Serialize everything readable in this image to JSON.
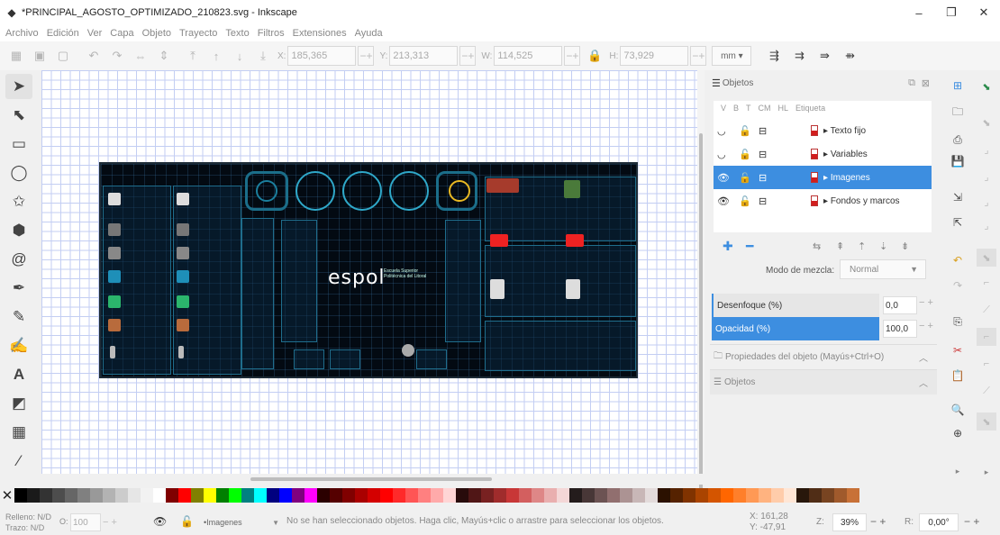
{
  "window": {
    "title": "*PRINCIPAL_AGOSTO_OPTIMIZADO_210823.svg - Inkscape",
    "minimize": "–",
    "maximize": "❐",
    "close": "✕"
  },
  "menu": [
    "Archivo",
    "Edición",
    "Ver",
    "Capa",
    "Objeto",
    "Trayecto",
    "Texto",
    "Filtros",
    "Extensiones",
    "Ayuda"
  ],
  "toolbar": {
    "x_label": "X:",
    "x_value": "185,365",
    "y_label": "Y:",
    "y_value": "213,313",
    "w_label": "W:",
    "w_value": "114,525",
    "h_label": "H:",
    "h_value": "73,929",
    "unit": "mm ▾",
    "minus": "−",
    "plus": "+"
  },
  "objects_panel": {
    "title": "Objetos",
    "columns": [
      "V",
      "B",
      "T",
      "CM",
      "HL",
      "Etiqueta"
    ],
    "layers": [
      {
        "name": "Texto fijo",
        "selected": false
      },
      {
        "name": "Variables",
        "selected": false
      },
      {
        "name": "Imagenes",
        "selected": true
      },
      {
        "name": "Fondos y marcos",
        "selected": false
      }
    ],
    "blend_label": "Modo de mezcla:",
    "blend_value": "Normal",
    "blur_label": "Desenfoque (%)",
    "blur_value": "0,0",
    "opacity_label": "Opacidad (%)",
    "opacity_value": "100,0",
    "props_section": "Propiedades del objeto (Mayús+Ctrl+O)",
    "objects_section": "Objetos"
  },
  "canvas": {
    "brand": "espol",
    "brand_sub": "Escuela Superior Politécnica del Litoral"
  },
  "status": {
    "fill_label": "Relleno: N/D",
    "stroke_label": "Trazo:",
    "stroke_value": "N/D",
    "o_label": "O:",
    "o_value": "100",
    "layer_value": "•Imagenes",
    "message": "No se han seleccionado objetos. Haga clic, Mayús+clic o arrastre para seleccionar los objetos.",
    "x_coord": "X:    161,28",
    "y_coord": "Y:    -47,91",
    "z_label": "Z:",
    "zoom": "39%",
    "r_label": "R:",
    "rotation": "0,00°"
  },
  "palette": [
    "#000000",
    "#1a1a1a",
    "#333333",
    "#4d4d4d",
    "#666666",
    "#808080",
    "#999999",
    "#b3b3b3",
    "#cccccc",
    "#e6e6e6",
    "#f2f2f2",
    "#ffffff",
    "#800000",
    "#ff0000",
    "#808000",
    "#ffff00",
    "#008000",
    "#00ff00",
    "#008080",
    "#00ffff",
    "#000080",
    "#0000ff",
    "#800080",
    "#ff00ff",
    "#2b0000",
    "#550000",
    "#800000",
    "#aa0000",
    "#d40000",
    "#ff0000",
    "#ff2a2a",
    "#ff5555",
    "#ff8080",
    "#ffaaaa",
    "#ffd5d5",
    "#280b0b",
    "#501616",
    "#782121",
    "#a02c2c",
    "#c83737",
    "#d35f5f",
    "#de8787",
    "#e9afaf",
    "#f4d7d7",
    "#241c1c",
    "#483737",
    "#6c5353",
    "#916f6f",
    "#ac9393",
    "#c8b7b7",
    "#e3dbdb",
    "#2b1100",
    "#552200",
    "#803300",
    "#aa4400",
    "#d45500",
    "#ff6600",
    "#ff7f2a",
    "#ff9955",
    "#ffb380",
    "#ffccaa",
    "#ffe6d5",
    "#28170b",
    "#502d16",
    "#784421",
    "#a05a2c",
    "#c87137"
  ]
}
